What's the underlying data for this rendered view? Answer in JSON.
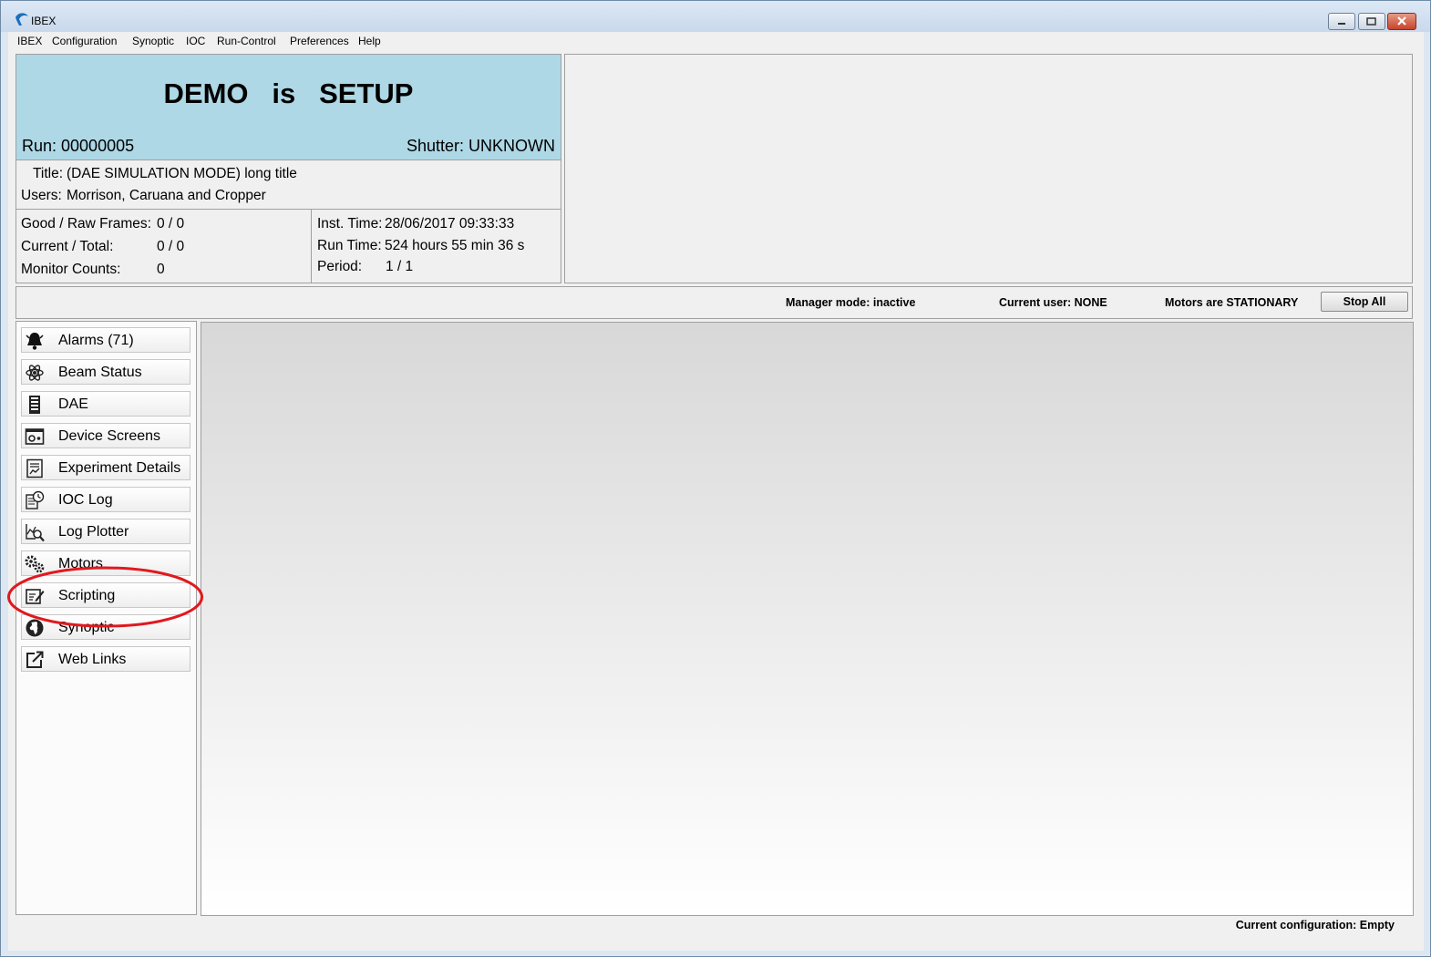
{
  "window": {
    "title": "IBEX"
  },
  "menu": [
    "IBEX",
    "Configuration",
    "Synoptic",
    "IOC",
    "Run-Control",
    "Preferences",
    "Help"
  ],
  "instrument": {
    "name": "DEMO",
    "state_word": "is",
    "state": "SETUP",
    "run": "Run: 00000005",
    "shutter": "Shutter: UNKNOWN",
    "title_label": "Title:",
    "title_value": "(DAE SIMULATION MODE) long title",
    "users_label": "Users:",
    "users_value": "Morrison, Caruana and Cropper"
  },
  "stats": {
    "good_raw_label": "Good / Raw Frames:",
    "good_raw_value": "0 / 0",
    "current_total_label": "Current / Total:",
    "current_total_value": "0 / 0",
    "monitor_label": "Monitor Counts:",
    "monitor_value": "0",
    "inst_time_label": "Inst. Time:",
    "inst_time_value": "28/06/2017 09:33:33",
    "run_time_label": "Run Time:",
    "run_time_value": "524 hours 55 min 36 s",
    "period_label": "Period:",
    "period_value": "1 / 1"
  },
  "statusbar": {
    "manager_mode": "Manager mode: inactive",
    "current_user": "Current user: NONE",
    "motors": "Motors are STATIONARY",
    "stop_all": "Stop All"
  },
  "perspectives": [
    {
      "label": "Alarms (71)",
      "icon": "bell-icon"
    },
    {
      "label": "Beam Status",
      "icon": "atom-icon"
    },
    {
      "label": "DAE",
      "icon": "dae-rack-icon"
    },
    {
      "label": "Device Screens",
      "icon": "device-screen-icon"
    },
    {
      "label": "Experiment Details",
      "icon": "document-chart-icon"
    },
    {
      "label": "IOC Log",
      "icon": "log-clock-icon"
    },
    {
      "label": "Log Plotter",
      "icon": "plot-magnifier-icon"
    },
    {
      "label": "Motors",
      "icon": "gears-icon"
    },
    {
      "label": "Scripting",
      "icon": "script-pencil-icon"
    },
    {
      "label": "Synoptic",
      "icon": "globe-icon"
    },
    {
      "label": "Web Links",
      "icon": "external-link-icon"
    }
  ],
  "footer": {
    "configuration": "Current configuration: Empty"
  },
  "colors": {
    "header_blue": "#aed8e6",
    "annotation_red": "#e0191e"
  }
}
